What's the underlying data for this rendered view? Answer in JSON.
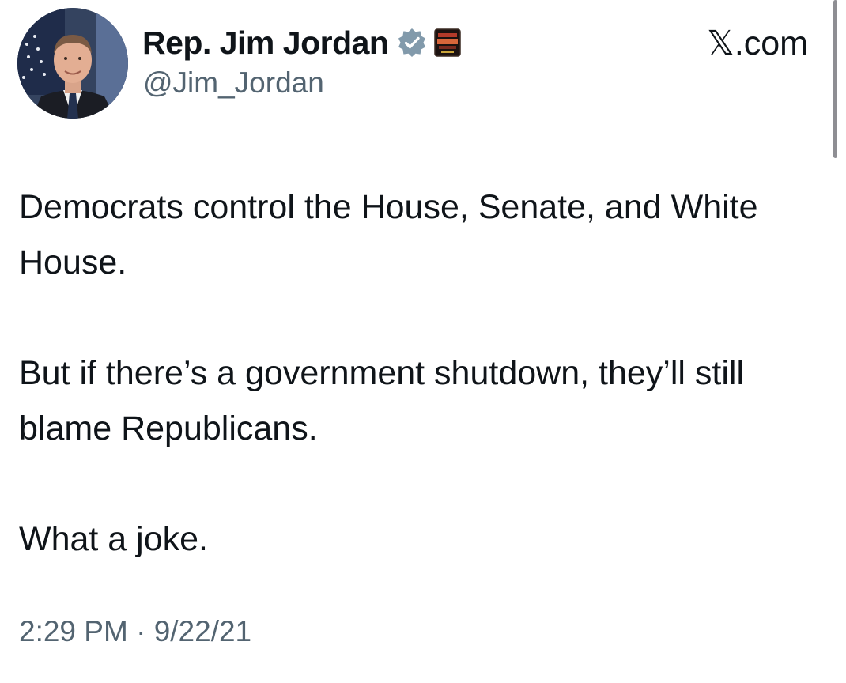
{
  "author": {
    "display_name": "Rep. Jim Jordan",
    "handle": "@Jim_Jordan",
    "verified_icon": "verified-badge-icon",
    "label_badge_icon": "affiliate-badge-icon"
  },
  "site": {
    "label": "𝕏.com"
  },
  "tweet": {
    "paragraphs": [
      "Democrats control the House, Senate, and White House.",
      "But if there’s a government shutdown, they’ll still blame Republicans.",
      "What a joke."
    ],
    "time": "2:29 PM",
    "separator": "·",
    "date": "9/22/21"
  },
  "colors": {
    "text": "#0f1419",
    "secondary_text": "#536471",
    "verified_badge": "#829aab"
  }
}
